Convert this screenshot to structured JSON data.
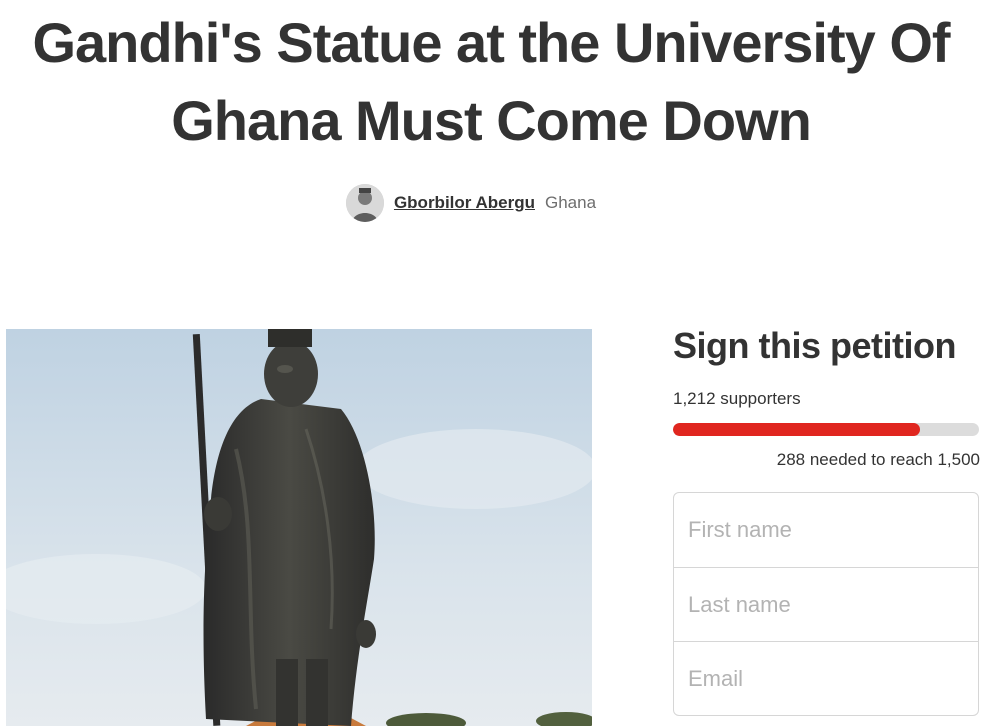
{
  "petition": {
    "title": "Gandhi's Statue at the University Of Ghana Must Come Down",
    "author_name": "Gborbilor Abergu",
    "author_location": "Ghana"
  },
  "photo": {
    "icon": "gandhi-statue-photo"
  },
  "sign": {
    "heading": "Sign this petition",
    "supporters_text": "1,212 supporters",
    "needed_text": "288 needed to reach 1,500",
    "supporters_count": 1212,
    "goal": 1500,
    "progress_fraction": 0.808,
    "progress_color": "#e0261f",
    "track_color": "#dcdcdc"
  },
  "form": {
    "first_name_placeholder": "First name",
    "last_name_placeholder": "Last name",
    "email_placeholder": "Email"
  }
}
